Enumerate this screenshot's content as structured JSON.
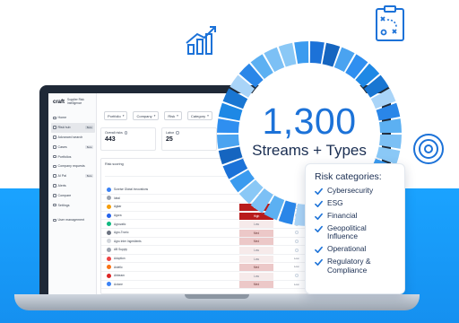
{
  "headline": {
    "number": "1,300",
    "subtitle": "Streams + Types"
  },
  "risk_card": {
    "title": "Risk categories:",
    "items": [
      {
        "label": "Cybersecurity"
      },
      {
        "label": "ESG"
      },
      {
        "label": "Financial"
      },
      {
        "label": "Geopolitical Influence"
      },
      {
        "label": "Operational"
      },
      {
        "label": "Regulatory & Compliance"
      }
    ]
  },
  "app": {
    "brand_logo": "craft",
    "brand_text": "Supplier Risk Intelligence",
    "nav": [
      {
        "label": "Home",
        "badge": ""
      },
      {
        "label": "Risk hub",
        "badge": "Beta",
        "active": true
      },
      {
        "label": "Advanced search",
        "badge": ""
      },
      {
        "label": "Cases",
        "badge": "Beta"
      },
      {
        "label": "Portfolios",
        "badge": ""
      },
      {
        "label": "Company requests",
        "badge": ""
      },
      {
        "label": "AI Pal",
        "badge": "Beta"
      },
      {
        "label": "Alerts",
        "badge": ""
      },
      {
        "label": "Compare",
        "badge": ""
      },
      {
        "label": "Settings",
        "badge": ""
      }
    ],
    "nav_bottom": [
      {
        "label": "User management",
        "badge": ""
      }
    ],
    "filters": [
      "Portfolio",
      "Company",
      "Risk",
      "Category"
    ],
    "kpis": [
      {
        "label": "Overall risks",
        "value": "443"
      },
      {
        "label": "Labor",
        "value": "25"
      }
    ],
    "panel_title": "Risk scoring",
    "rows": [
      {
        "name": "Sunrise Global Innovations",
        "chip": "",
        "level": "none",
        "logo": "#3b82f6",
        "c2": "",
        "c3": ""
      },
      {
        "name": "Ideal",
        "chip": "",
        "level": "none",
        "logo": "#9ca3af",
        "c2": "",
        "c3": ""
      },
      {
        "name": "Agkar",
        "chip": "High",
        "level": "high",
        "logo": "#f59e0b",
        "c2": "",
        "c3": ""
      },
      {
        "name": "Agora",
        "chip": "High",
        "level": "high",
        "logo": "#2563eb",
        "c2": "",
        "c3": ""
      },
      {
        "name": "Agrovatic",
        "chip": "Low",
        "level": "low",
        "logo": "#10b981",
        "c2": "",
        "c3": ""
      },
      {
        "name": "Agro-Tronic",
        "chip": "Med",
        "level": "med",
        "logo": "#6b7280",
        "c2": "",
        "c3": ""
      },
      {
        "name": "Agro Inter Ingredients",
        "chip": "Med",
        "level": "med",
        "logo": "#d1d5db",
        "c2": "",
        "c3": ""
      },
      {
        "name": "AB Supply",
        "chip": "Low",
        "level": "low",
        "logo": "#9ca3af",
        "c2": "",
        "c3": ""
      },
      {
        "name": "Adoption",
        "chip": "Low",
        "level": "low",
        "logo": "#ef4444",
        "c2": "Low",
        "c3": ""
      },
      {
        "name": "Astello",
        "chip": "Med",
        "level": "med",
        "logo": "#f97316",
        "c2": "Low",
        "c3": "Low"
      },
      {
        "name": "Abbeam",
        "chip": "Low",
        "level": "low",
        "logo": "#dc2626",
        "c2": "",
        "c3": ""
      },
      {
        "name": "Actone",
        "chip": "Med",
        "level": "med",
        "logo": "#3b82f6",
        "c2": "Low",
        "c3": "Low"
      }
    ]
  },
  "colors": {
    "accent_blue": "#1c72d8",
    "navy": "#1a2e52",
    "slab": "#1aa3ff"
  }
}
